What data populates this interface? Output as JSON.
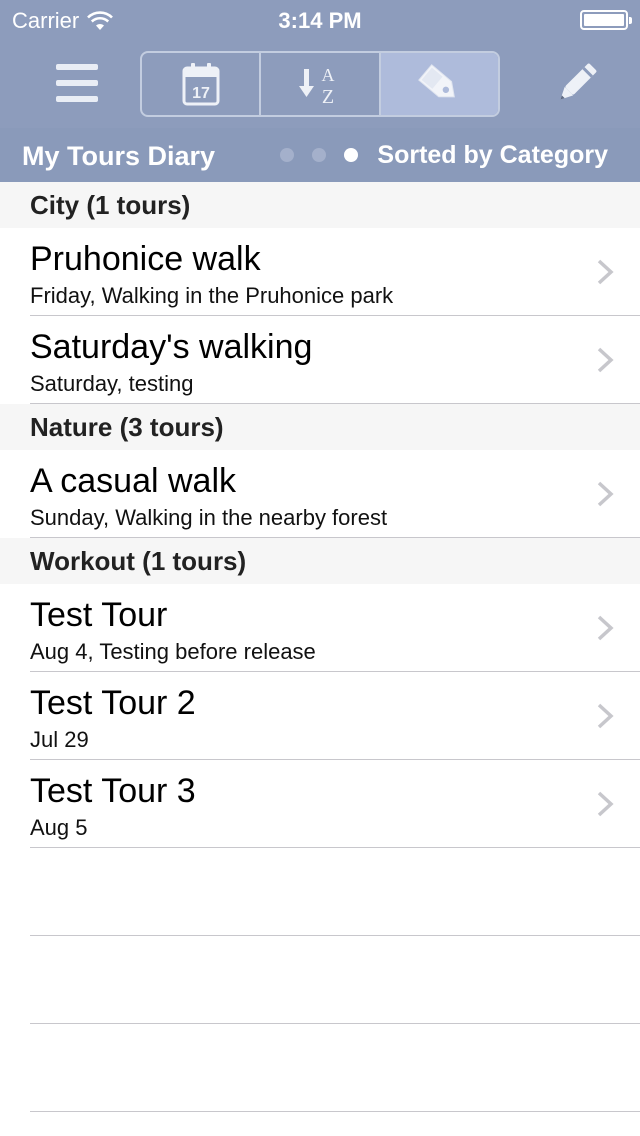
{
  "status_bar": {
    "carrier": "Carrier",
    "time": "3:14 PM"
  },
  "toolbar": {
    "segments": [
      {
        "icon": "calendar-icon",
        "text": "17"
      },
      {
        "icon": "sort-alpha-icon",
        "text_a": "A",
        "text_z": "Z"
      },
      {
        "icon": "tag-icon"
      }
    ],
    "active_segment": 2
  },
  "subheader": {
    "title": "My Tours Diary",
    "sort_label": "Sorted by Category",
    "page_count": 3,
    "page_active": 2
  },
  "sections": [
    {
      "header": "City (1 tours)",
      "rows": [
        {
          "title": "Pruhonice walk",
          "subtitle": "Friday, Walking in the Pruhonice park"
        },
        {
          "title": "Saturday's walking",
          "subtitle": "Saturday, testing"
        }
      ]
    },
    {
      "header": "Nature (3 tours)",
      "rows": [
        {
          "title": "A casual walk",
          "subtitle": "Sunday, Walking in the nearby forest"
        }
      ]
    },
    {
      "header": "Workout (1 tours)",
      "rows": [
        {
          "title": "Test Tour",
          "subtitle": "Aug 4, Testing before release"
        },
        {
          "title": "Test Tour 2",
          "subtitle": "Jul 29"
        },
        {
          "title": "Test Tour 3",
          "subtitle": "Aug 5"
        }
      ]
    }
  ],
  "colors": {
    "bar_bg": "#8d9cbc",
    "active_segment": "#aebbdb",
    "section_bg": "#f6f6f6",
    "separator": "#c8c7cc"
  }
}
